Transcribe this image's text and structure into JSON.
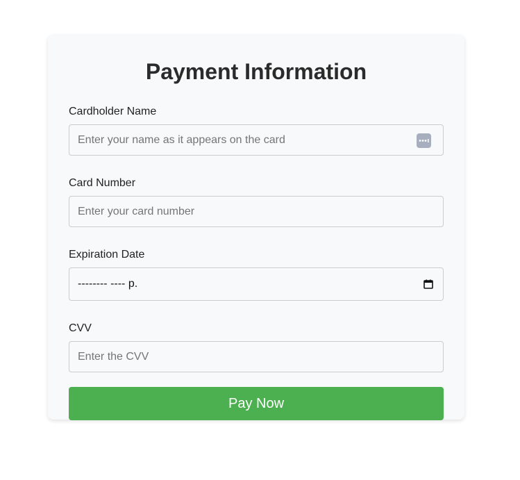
{
  "form": {
    "title": "Payment Information",
    "cardholder": {
      "label": "Cardholder Name",
      "placeholder": "Enter your name as it appears on the card"
    },
    "card_number": {
      "label": "Card Number",
      "placeholder": "Enter your card number"
    },
    "expiration": {
      "label": "Expiration Date",
      "value": "-------- ---- р."
    },
    "cvv": {
      "label": "CVV",
      "placeholder": "Enter the CVV"
    },
    "submit_label": "Pay Now"
  },
  "colors": {
    "button": "#4caf50",
    "card_background": "#f8f9fa"
  },
  "icons": {
    "autofill": "autofill-icon",
    "calendar": "calendar-icon"
  }
}
